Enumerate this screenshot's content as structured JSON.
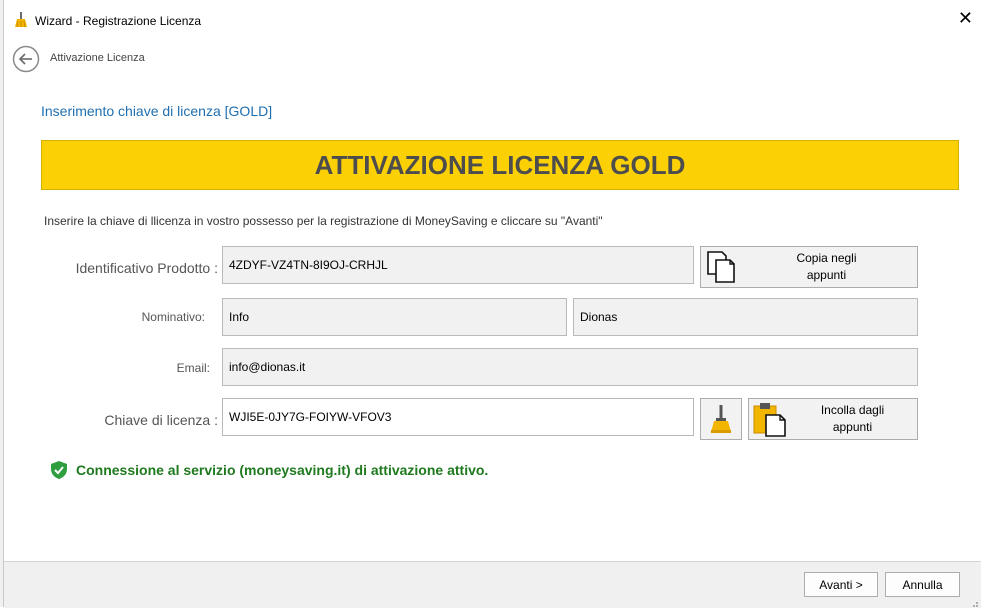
{
  "window": {
    "title": "Wizard - Registrazione Licenza",
    "close_glyph": "✕"
  },
  "header": {
    "breadcrumb": "Attivazione Licenza"
  },
  "main": {
    "section_title": "Inserimento chiave di licenza [GOLD]",
    "banner": "ATTIVAZIONE LICENZA GOLD",
    "instructions": "Inserire la chiave di llicenza in vostro possesso per la registrazione di MoneySaving e cliccare su \"Avanti\"",
    "product_id": {
      "label": "Identificativo Prodotto :",
      "value": "4ZDYF-VZ4TN-8I9OJ-CRHJL"
    },
    "copy_button": {
      "line1": "Copia negli",
      "line2": "appunti"
    },
    "name": {
      "label": "Nominativo:",
      "first": "Info",
      "last": "Dionas"
    },
    "email": {
      "label": "Email:",
      "value": "info@dionas.it"
    },
    "license_key": {
      "label": "Chiave di licenza :",
      "value": "WJI5E-0JY7G-FOIYW-VFOV3"
    },
    "paste_button": {
      "line1": "Incolla dagli",
      "line2": "appunti"
    },
    "status": "Connessione al servizio (moneysaving.it) di attivazione attivo."
  },
  "footer": {
    "next": "Avanti >",
    "cancel": "Annulla"
  },
  "icons": {
    "app": "broom-icon",
    "back": "back-arrow-icon",
    "copy": "copy-icon",
    "clear": "broom-icon",
    "paste": "paste-icon",
    "status": "shield-check-icon"
  },
  "colors": {
    "banner": "#fbd106",
    "accent": "#1f6fb0",
    "status": "#1f7a1f"
  }
}
